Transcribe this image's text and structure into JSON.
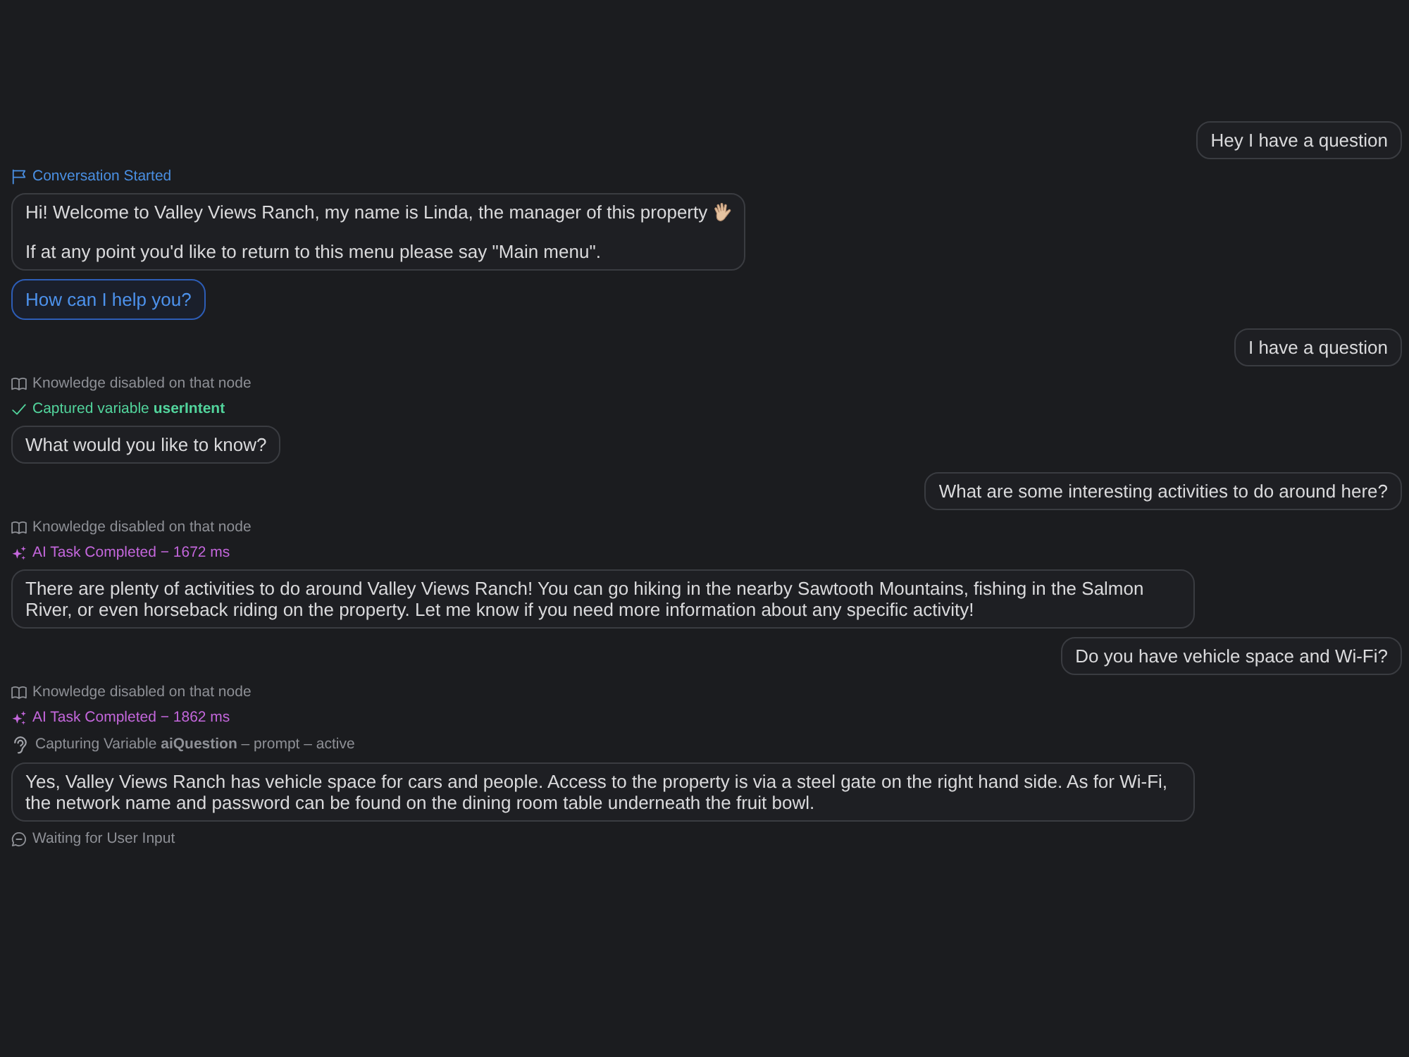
{
  "conversation": [
    {
      "kind": "user",
      "text": "Hey I have a question"
    },
    {
      "kind": "started",
      "text": "Conversation Started"
    },
    {
      "kind": "bot",
      "paragraphs": [
        {
          "text": "Hi! Welcome to Valley Views Ranch, my name is Linda, the manager of this property",
          "trailing_icon": true
        },
        {
          "text": "If at any point you'd like to return to this menu please say \"Main menu\"."
        }
      ]
    },
    {
      "kind": "choice",
      "text": "How can I help you?"
    },
    {
      "kind": "user",
      "text": "I have a question"
    },
    {
      "kind": "knowledge",
      "text": "Knowledge disabled on that node"
    },
    {
      "kind": "captured",
      "text": "Captured variable **userIntent**"
    },
    {
      "kind": "bot",
      "paragraphs": [
        {
          "text": "What would you like to know?"
        }
      ]
    },
    {
      "kind": "user",
      "text": "What are some interesting activities to do around here?"
    },
    {
      "kind": "knowledge",
      "text": "Knowledge disabled on that node"
    },
    {
      "kind": "task",
      "text": "AI Task Completed − 1672 ms"
    },
    {
      "kind": "bot",
      "paragraphs": [
        {
          "text": "There are plenty of activities to do around Valley Views Ranch! You can go hiking in the nearby Sawtooth Mountains, fishing in the Salmon River, or even horseback riding on the property. Let me know if you need more information about any specific activity!"
        }
      ]
    },
    {
      "kind": "user",
      "text": "Do you have vehicle space and Wi-Fi?"
    },
    {
      "kind": "knowledge",
      "text": "Knowledge disabled on that node"
    },
    {
      "kind": "task",
      "text": "AI Task Completed − 1862 ms"
    },
    {
      "kind": "capturing",
      "text": "Capturing Variable **aiQuestion** – prompt – active"
    },
    {
      "kind": "bot",
      "paragraphs": [
        {
          "text": "Yes, Valley Views Ranch has vehicle space for cars and people. Access to the property is via a steel gate on the right hand side. As for Wi-Fi, the network name and password can be found on the dining room table underneath the fruit bowl."
        }
      ]
    },
    {
      "kind": "waiting",
      "text": "Waiting for User Input"
    }
  ]
}
